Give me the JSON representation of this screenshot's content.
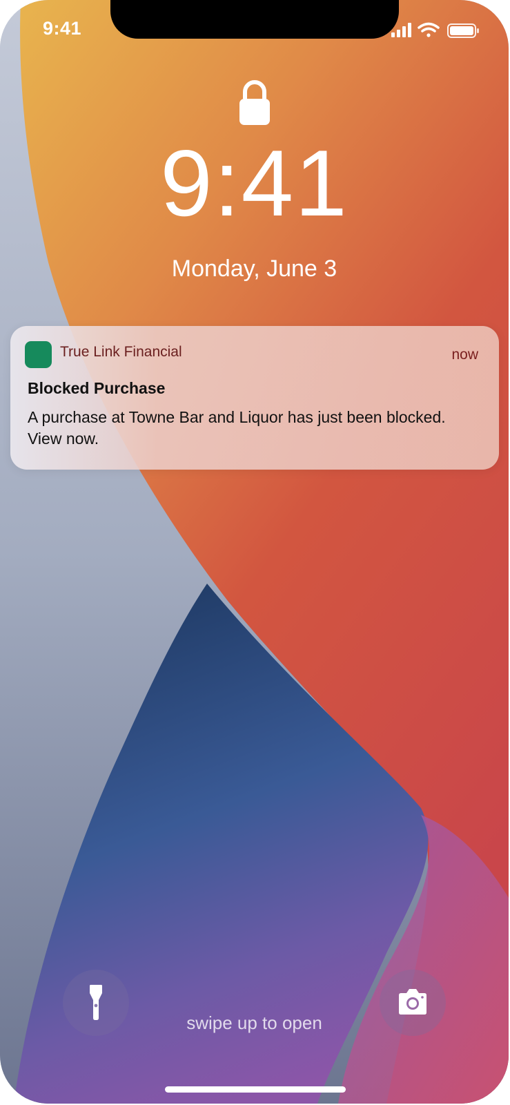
{
  "status_bar": {
    "time": "9:41",
    "icons": [
      "cellular-signal-icon",
      "wifi-icon",
      "battery-icon"
    ]
  },
  "lock_screen": {
    "lock_icon": "lock-icon",
    "time": "9:41",
    "date": "Monday, June 3"
  },
  "notification": {
    "app_name": "True Link Financial",
    "app_icon_color": "#168a5c",
    "time": "now",
    "title": "Blocked Purchase",
    "body": "A purchase at Towne Bar and Liquor has just been blocked. View now."
  },
  "bottom": {
    "flashlight_icon": "flashlight-icon",
    "camera_icon": "camera-icon",
    "swipe_hint": "swipe up to open"
  },
  "colors": {
    "wallpaper_orange": "#e39a4a",
    "wallpaper_red": "#cc4a42",
    "wallpaper_blue": "#2f4f86",
    "wallpaper_purple": "#8a5aa8",
    "wallpaper_gray": "#b5bccb"
  }
}
